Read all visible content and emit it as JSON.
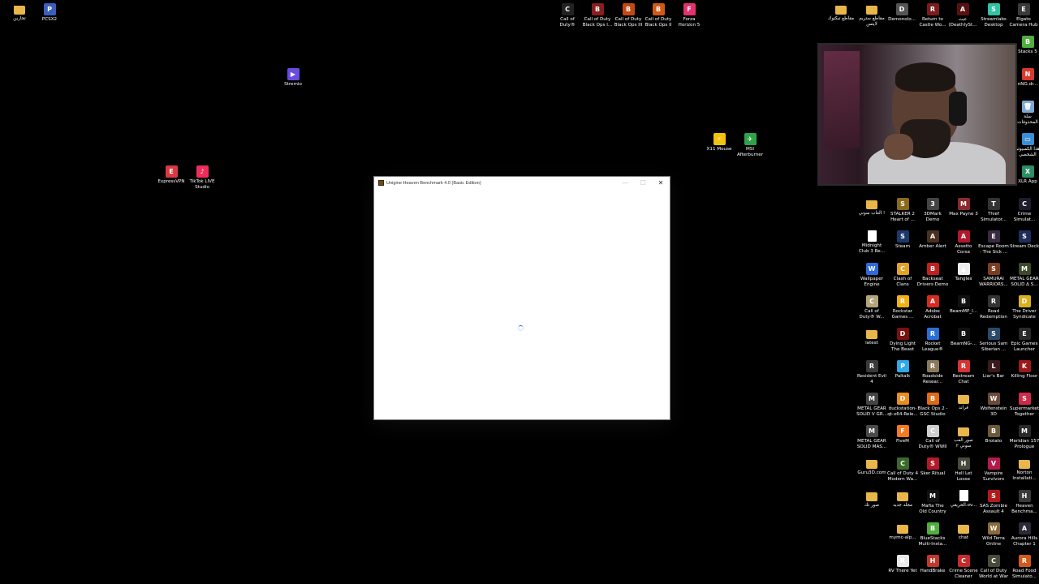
{
  "desktop_left": [
    {
      "label": "تجارين",
      "type": "folder",
      "color": "#e8b64a"
    },
    {
      "label": "PCSX2",
      "type": "app",
      "color": "#3a5fbf",
      "glyph": "P"
    },
    {
      "label": "Stremio",
      "type": "app",
      "color": "#6a4be0",
      "glyph": "▶"
    },
    {
      "label": "ExpressVPN",
      "type": "app",
      "color": "#da3940",
      "glyph": "E"
    },
    {
      "label": "TikTok LIVE\nStudio",
      "type": "app",
      "color": "#ee2d5b",
      "glyph": "♪"
    },
    {
      "label": "Call of\nDuty®",
      "type": "app",
      "color": "#222",
      "glyph": "C"
    },
    {
      "label": "Call of Duty\nBlack Ops I...",
      "type": "app",
      "color": "#8a1d1d",
      "glyph": "B"
    },
    {
      "label": "Call of Duty\nBlack Ops III",
      "type": "app",
      "color": "#c24a12",
      "glyph": "B"
    },
    {
      "label": "Call of Duty\nBlack Ops II",
      "type": "app",
      "color": "#d05a14",
      "glyph": "B"
    },
    {
      "label": "Forza\nHorizon 5",
      "type": "app",
      "color": "#e3316d",
      "glyph": "F"
    },
    {
      "label": "X11 Mouse",
      "type": "app",
      "color": "#f2c20e",
      "glyph": "⚡"
    },
    {
      "label": "MSI\nAfterburner",
      "type": "app",
      "color": "#2fa34a",
      "glyph": "✈"
    }
  ],
  "desktop_top_right": [
    {
      "label": "مقاطع تيكتوك",
      "type": "folder",
      "color": "#e8b64a"
    },
    {
      "label": "مقاطع ستريم\nلايتس",
      "type": "folder",
      "color": "#e8b64a"
    },
    {
      "label": "Demonolo...",
      "type": "app",
      "color": "#555",
      "glyph": "D"
    },
    {
      "label": "Return to\nCastle Wo...",
      "type": "app",
      "color": "#7a1c1c",
      "glyph": "R"
    },
    {
      "label": "عبث\n(DeathlySt...",
      "type": "app",
      "color": "#5a1010",
      "glyph": "A"
    },
    {
      "label": "Streamlabs\nDesktop",
      "type": "app",
      "color": "#31c3a2",
      "glyph": "S"
    },
    {
      "label": "Elgato\nCamera Hub",
      "type": "app",
      "color": "#3a3a3a",
      "glyph": "E"
    }
  ],
  "desktop_right_edge": [
    {
      "label": "Stacks 5",
      "type": "app",
      "color": "#4fae3d",
      "glyph": "B"
    },
    {
      "label": "nNG.dr...",
      "type": "app",
      "color": "#d83a2f",
      "glyph": "N"
    },
    {
      "label": "سلة\nالمحذوفات",
      "type": "app",
      "color": "#7fa9d1",
      "glyph": "🗑"
    },
    {
      "label": "هذا الكمبيوتر\nالشخصي",
      "type": "app",
      "color": "#3b8fd6",
      "glyph": "▭"
    },
    {
      "label": "XLR App",
      "type": "app",
      "color": "#2c8f66",
      "glyph": "X"
    }
  ],
  "desktop_grid": [
    [
      {
        "label": "العاب سوني !",
        "type": "folder",
        "color": "#e8b64a"
      },
      {
        "label": "STALKER 2\nHeart of ...",
        "type": "app",
        "color": "#8a6a1a",
        "glyph": "S"
      },
      {
        "label": "3DMark\nDemo",
        "type": "app",
        "color": "#444",
        "glyph": "3"
      },
      {
        "label": "Max Payne 3",
        "type": "app",
        "color": "#8a2a2a",
        "glyph": "M"
      },
      {
        "label": "Thief\nSimulator...",
        "type": "app",
        "color": "#333",
        "glyph": "T"
      },
      {
        "label": "Crime\nSimulat...",
        "type": "app",
        "color": "#1d1d2d",
        "glyph": "C"
      }
    ],
    [
      {
        "label": "Midnight\nClub 3 Re...",
        "type": "doc",
        "color": "#ffffff"
      },
      {
        "label": "Steam",
        "type": "app",
        "color": "#1b3a6b",
        "glyph": "S"
      },
      {
        "label": "Amber Alert",
        "type": "app",
        "color": "#4a3020",
        "glyph": "A"
      },
      {
        "label": "Assetto\nCorsa",
        "type": "app",
        "color": "#b2182b",
        "glyph": "A"
      },
      {
        "label": "Escape Room\n- The Sick ...",
        "type": "app",
        "color": "#3a2a40",
        "glyph": "E"
      },
      {
        "label": "Stream Deck",
        "type": "app",
        "color": "#1f2d5a",
        "glyph": "S"
      }
    ],
    [
      {
        "label": "Wallpaper\nEngine",
        "type": "app",
        "color": "#2d6bd6",
        "glyph": "W"
      },
      {
        "label": "Clash of\nClans",
        "type": "app",
        "color": "#e1a227",
        "glyph": "C"
      },
      {
        "label": "Backseat\nDrivers Demo",
        "type": "app",
        "color": "#c41f1f",
        "glyph": "B"
      },
      {
        "label": "Tangles",
        "type": "app",
        "color": "#eee",
        "glyph": "▲"
      },
      {
        "label": "SAMURAI\nWARRIORS...",
        "type": "app",
        "color": "#7a3d1e",
        "glyph": "S"
      },
      {
        "label": "METAL GEAR\nSOLID Δ S...",
        "type": "app",
        "color": "#3d4a2a",
        "glyph": "M"
      }
    ],
    [
      {
        "label": "Call of\nDuty® W...",
        "type": "app",
        "color": "#b5a57a",
        "glyph": "C"
      },
      {
        "label": "Rockstar\nGames ...",
        "type": "app",
        "color": "#f1b211",
        "glyph": "R"
      },
      {
        "label": "Adobe\nAcrobat",
        "type": "app",
        "color": "#d62b1f",
        "glyph": "A"
      },
      {
        "label": "BeamMP_l...",
        "type": "app",
        "color": "#111",
        "glyph": "B"
      },
      {
        "label": "Road\nRedemption",
        "type": "app",
        "color": "#333",
        "glyph": "R"
      },
      {
        "label": "The Driver\nSyndicate",
        "type": "app",
        "color": "#d9b11f",
        "glyph": "D"
      }
    ],
    [
      {
        "label": "latest",
        "type": "folder",
        "color": "#e8b64a"
      },
      {
        "label": "Dying Light\nThe Beast",
        "type": "app",
        "color": "#7a1010",
        "glyph": "D"
      },
      {
        "label": "Rocket\nLeague®",
        "type": "app",
        "color": "#2a6fd6",
        "glyph": "R"
      },
      {
        "label": "BeamNG-...",
        "type": "app",
        "color": "#111",
        "glyph": "B"
      },
      {
        "label": "Serious Sam\nSiberian ...",
        "type": "app",
        "color": "#2b4a6a",
        "glyph": "S"
      },
      {
        "label": "Epic Games\nLauncher",
        "type": "app",
        "color": "#2a2a2a",
        "glyph": "E"
      }
    ],
    [
      {
        "label": "Resident Evil\n4",
        "type": "app",
        "color": "#3a3a3a",
        "glyph": "R"
      },
      {
        "label": "Paltalk",
        "type": "app",
        "color": "#2fa9e8",
        "glyph": "P"
      },
      {
        "label": "Roadside\nResear...",
        "type": "app",
        "color": "#8a7a5a",
        "glyph": "R"
      },
      {
        "label": "Restream\nChat",
        "type": "app",
        "color": "#d63333",
        "glyph": "R"
      },
      {
        "label": "Liar's Bar",
        "type": "app",
        "color": "#3a1a1a",
        "glyph": "L"
      },
      {
        "label": "Killing Floor",
        "type": "app",
        "color": "#9a1a1a",
        "glyph": "K"
      }
    ],
    [
      {
        "label": "METAL GEAR\nSOLID V GR...",
        "type": "app",
        "color": "#444",
        "glyph": "M"
      },
      {
        "label": "duckstation-\nqt-x64-Rele...",
        "type": "app",
        "color": "#e88e1f",
        "glyph": "D"
      },
      {
        "label": "Black Ops 2 -\nGSC Studio",
        "type": "app",
        "color": "#e06a14",
        "glyph": "B"
      },
      {
        "label": "قراند",
        "type": "folder",
        "color": "#e8b64a"
      },
      {
        "label": "Wolfenstein\n3D",
        "type": "app",
        "color": "#6a4a3a",
        "glyph": "W"
      },
      {
        "label": "Supermarket\nTogether",
        "type": "app",
        "color": "#d02a4a",
        "glyph": "S"
      }
    ],
    [
      {
        "label": "METAL GEAR\nSOLID MAS...",
        "type": "app",
        "color": "#4a4a4a",
        "glyph": "M"
      },
      {
        "label": "FiveM",
        "type": "app",
        "color": "#f47b20",
        "glyph": "F"
      },
      {
        "label": "Call of\nDuty® WWII",
        "type": "app",
        "color": "#cfcfcf",
        "glyph": "C"
      },
      {
        "label": "صور العب\nسوني ٢",
        "type": "folder",
        "color": "#e8b64a"
      },
      {
        "label": "Brotato",
        "type": "app",
        "color": "#6a5a3a",
        "glyph": "B"
      },
      {
        "label": "Meridian 157\nPrologue",
        "type": "app",
        "color": "#2a2a2a",
        "glyph": "M"
      }
    ],
    [
      {
        "label": "Guru3D.com",
        "type": "folder",
        "color": "#e8b64a"
      },
      {
        "label": "Call of Duty 4\nModern Wa...",
        "type": "app",
        "color": "#3a6a2a",
        "glyph": "C"
      },
      {
        "label": "Sker Ritual",
        "type": "app",
        "color": "#b21a2a",
        "glyph": "S"
      },
      {
        "label": "Hell Let\nLoose",
        "type": "app",
        "color": "#4a4a3a",
        "glyph": "H"
      },
      {
        "label": "Vampire\nSurvivors",
        "type": "app",
        "color": "#b21a4a",
        "glyph": "V"
      },
      {
        "label": "Norton\nInstallati...",
        "type": "folder",
        "color": "#e8b64a"
      }
    ],
    [
      {
        "label": "صور تك",
        "type": "folder",
        "color": "#e8b64a"
      },
      {
        "label": "مجلد جديد",
        "type": "folder",
        "color": "#e8b64a"
      },
      {
        "label": "Mafia The\nOld Country",
        "type": "app",
        "color": "#111",
        "glyph": "M"
      },
      {
        "label": "الحريقي.ov...",
        "type": "doc",
        "color": "#ffffff"
      },
      {
        "label": "SAS Zombie\nAssault 4",
        "type": "app",
        "color": "#b21a1a",
        "glyph": "S"
      },
      {
        "label": "Heaven\nBenchma...",
        "type": "app",
        "color": "#3a3a3a",
        "glyph": "H"
      }
    ],
    [
      {
        "label": "",
        "type": "none",
        "color": "#000"
      },
      {
        "label": "mymc-alp...",
        "type": "folder",
        "color": "#e8b64a"
      },
      {
        "label": "BlueStacks\nMulti-Insta...",
        "type": "app",
        "color": "#4fae3d",
        "glyph": "B"
      },
      {
        "label": "chat",
        "type": "folder",
        "color": "#e8b64a"
      },
      {
        "label": "Wild Terra\nOnline",
        "type": "app",
        "color": "#8a6a3a",
        "glyph": "W"
      },
      {
        "label": "Aurora Hills\nChapter 1",
        "type": "app",
        "color": "#2a2a3a",
        "glyph": "A"
      }
    ],
    [
      {
        "label": "",
        "type": "none",
        "color": "#000"
      },
      {
        "label": "RV There Yet",
        "type": "app",
        "color": "#e8e8e8",
        "glyph": "R"
      },
      {
        "label": "HandBrake",
        "type": "app",
        "color": "#c0392b",
        "glyph": "H"
      },
      {
        "label": "Crime Scene\nCleaner",
        "type": "app",
        "color": "#c62a2a",
        "glyph": "C"
      },
      {
        "label": "Call of Duty\nWorld at War",
        "type": "app",
        "color": "#4a4a3a",
        "glyph": "C"
      },
      {
        "label": "Road Food\nSimulato...",
        "type": "app",
        "color": "#d05a1a",
        "glyph": "R"
      }
    ]
  ],
  "window": {
    "title": "Unigine Heaven Benchmark 4.0 (Basic Edition)",
    "minimize": "—",
    "maximize": "☐",
    "close": "✕",
    "state": "loading"
  }
}
